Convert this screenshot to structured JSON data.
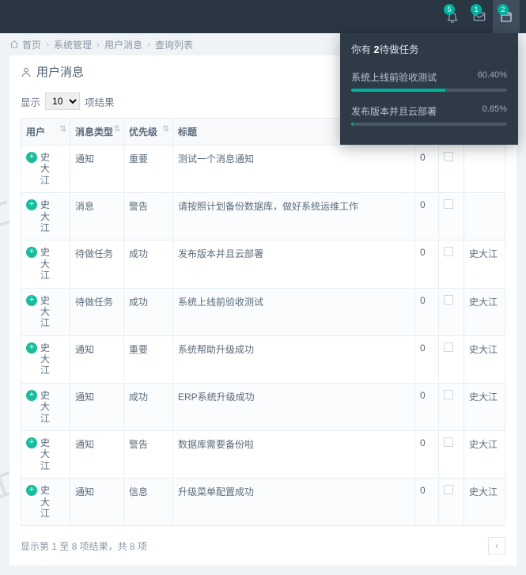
{
  "watermark_text": "上海邑泊",
  "topbar": {
    "notif_badge": "5",
    "mail_badge": "1",
    "tasks_badge": "2",
    "notif_icon": "bell-icon",
    "mail_icon": "envelope-icon",
    "tasks_icon": "calendar-icon"
  },
  "breadcrumb": {
    "home": "首页",
    "l1": "系统管理",
    "l2": "用户消息",
    "l3": "查询列表"
  },
  "page": {
    "title": "用户消息",
    "show_label": "显示",
    "entries_label": "项结果",
    "page_length_value": "10",
    "page_length_options": [
      "10"
    ],
    "info": "显示第 1 至 8 项结果，共 8 项"
  },
  "columns": {
    "user": "用户",
    "type": "消息类型",
    "priority": "优先级",
    "title": "标题",
    "count": "",
    "flag": "",
    "sender": ""
  },
  "rows": [
    {
      "user": "史大江",
      "type": "通知",
      "priority": "重要",
      "title": "测试一个消息通知",
      "count": "0",
      "flag": false,
      "sender": ""
    },
    {
      "user": "史大江",
      "type": "消息",
      "priority": "警告",
      "title": "请按照计划备份数据库，做好系统运维工作",
      "count": "0",
      "flag": false,
      "sender": ""
    },
    {
      "user": "史大江",
      "type": "待做任务",
      "priority": "成功",
      "title": "发布版本并且云部署",
      "count": "0",
      "flag": false,
      "sender": "史大江"
    },
    {
      "user": "史大江",
      "type": "待做任务",
      "priority": "成功",
      "title": "系统上线前验收测试",
      "count": "0",
      "flag": false,
      "sender": "史大江"
    },
    {
      "user": "史大江",
      "type": "通知",
      "priority": "重要",
      "title": "系统帮助升级成功",
      "count": "0",
      "flag": false,
      "sender": "史大江"
    },
    {
      "user": "史大江",
      "type": "通知",
      "priority": "成功",
      "title": "ERP系统升级成功",
      "count": "0",
      "flag": false,
      "sender": "史大江"
    },
    {
      "user": "史大江",
      "type": "通知",
      "priority": "警告",
      "title": "数据库需要备份啦",
      "count": "0",
      "flag": false,
      "sender": "史大江"
    },
    {
      "user": "史大江",
      "type": "通知",
      "priority": "信息",
      "title": "升级菜单配置成功",
      "count": "0",
      "flag": false,
      "sender": "史大江"
    }
  ],
  "tasks_panel": {
    "pre": "你有 ",
    "count": "2",
    "post": "待做任务",
    "tasks": [
      {
        "name": "系统上线前验收测试",
        "percent": "60.40%",
        "value": 60.4,
        "color": "#00b19d"
      },
      {
        "name": "发布版本并且云部署",
        "percent": "0.85%",
        "value": 0.85,
        "color": "#00b19d"
      }
    ]
  }
}
